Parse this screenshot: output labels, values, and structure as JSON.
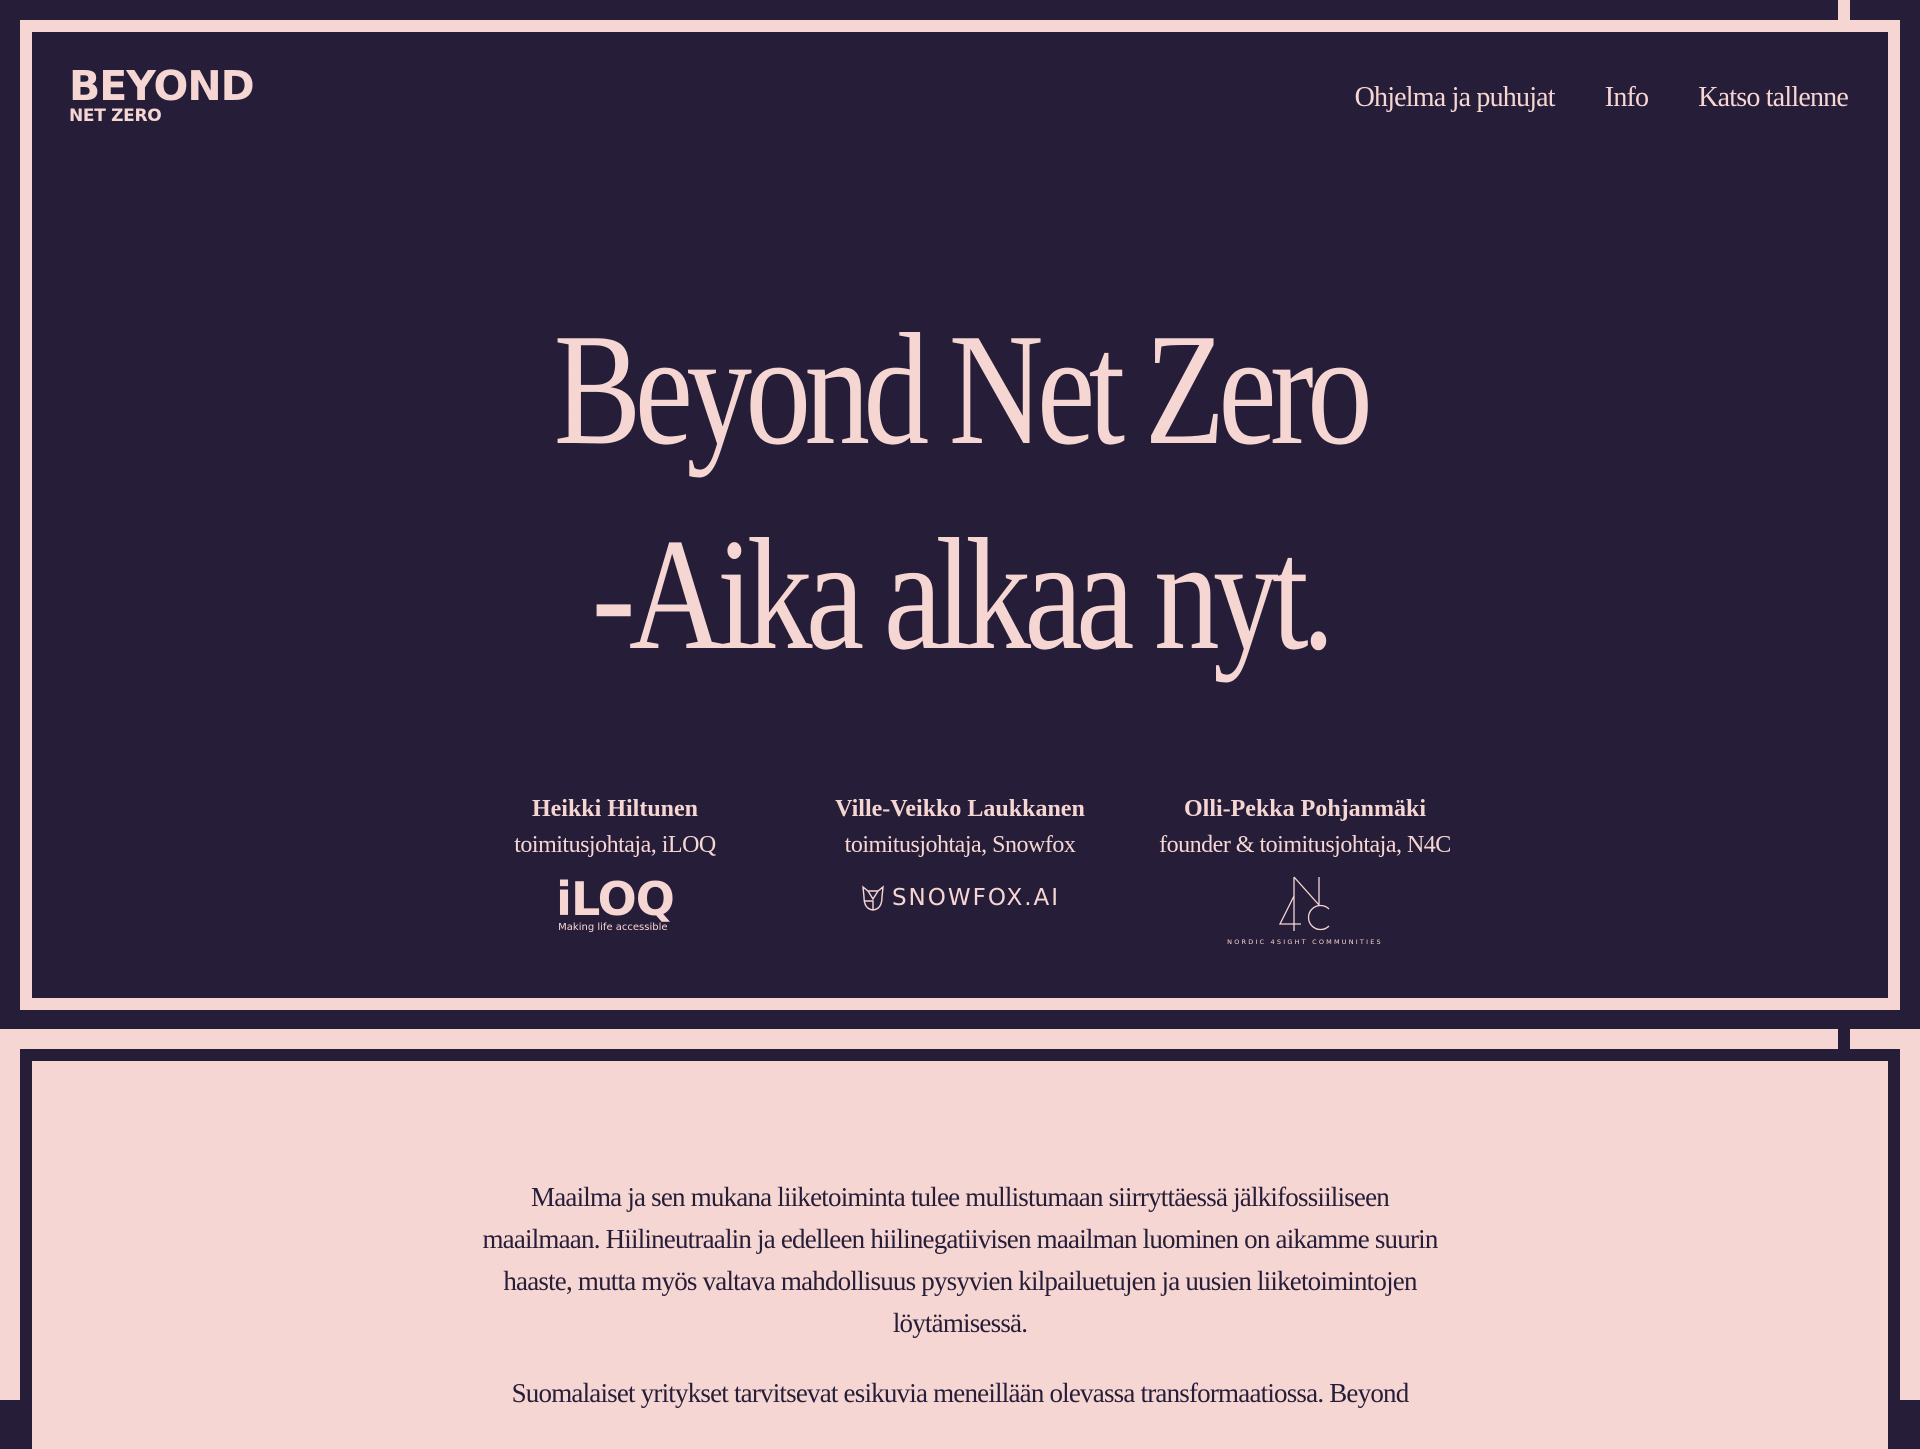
{
  "header": {
    "logo": {
      "line1": "BEYOND",
      "line2": "NET ZERO"
    },
    "nav": [
      {
        "label": "Ohjelma ja puhujat"
      },
      {
        "label": "Info"
      },
      {
        "label": "Katso tallenne"
      }
    ]
  },
  "hero": {
    "headline_line1": "Beyond Net Zero",
    "headline_line2": "-Aika alkaa nyt."
  },
  "speakers": [
    {
      "name": "Heikki Hiltunen",
      "role": "toimitusjohtaja, iLOQ",
      "logo_text": "iLOQ",
      "logo_tagline": "Making life accessible"
    },
    {
      "name": "Ville-Veikko Laukkanen",
      "role": "toimitusjohtaja, Snowfox",
      "logo_text": "SNOWFOX.AI"
    },
    {
      "name": "Olli-Pekka Pohjanmäki",
      "role": "founder & toimitusjohtaja, N4C",
      "logo_text": "N4C",
      "logo_tagline": "NORDIC 4SIGHT COMMUNITIES"
    }
  ],
  "intro": {
    "paragraphs": [
      "Maailma ja sen mukana liiketoiminta tulee mullistumaan siirryttäessä jälkifossiiliseen maailmaan. Hiilineutraalin ja edelleen hiilinegatiivisen maailman luominen on aikamme suurin haaste, mutta myös valtava mahdollisuus pysyvien kilpailuetujen ja uusien liiketoimintojen löytämisessä.",
      "Suomalaiset yritykset tarvitsevat esikuvia meneillään olevassa transformaatiossa. Beyond"
    ]
  },
  "colors": {
    "dark": "#261d38",
    "pink": "#f6d6d2"
  }
}
